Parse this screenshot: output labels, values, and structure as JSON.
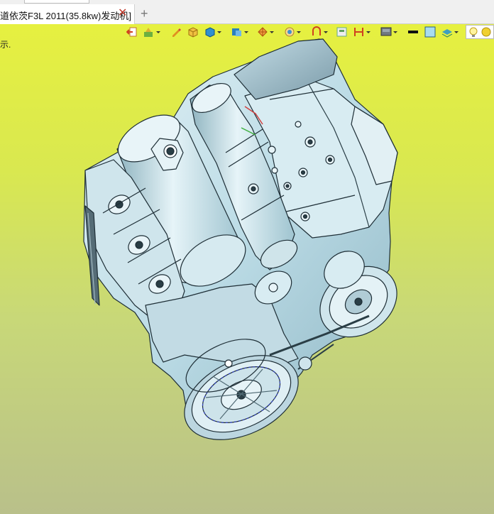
{
  "window": {
    "tab_title": "道依茨F3L 2011(35.8kw)发动机]",
    "close_glyph": "✕",
    "new_tab_glyph": "+"
  },
  "viewport": {
    "hint_text": "示.",
    "background_top": "#e6f040",
    "background_bottom": "#b9c08a"
  },
  "toolbar": {
    "icons": [
      "exit-sketch-icon",
      "feature-icon",
      "pencil-icon",
      "box-icon",
      "solid-icon",
      "render-style-icon",
      "section-icon",
      "view-orient-icon",
      "measure-icon",
      "grid-icon",
      "align-icon",
      "display-icon",
      "line-color-icon",
      "fill-color-icon",
      "layer-icon",
      "light-bulb-icon",
      "sun-icon"
    ]
  },
  "model": {
    "name": "engine-3d-model",
    "shade_color": "#bfe0ea"
  }
}
